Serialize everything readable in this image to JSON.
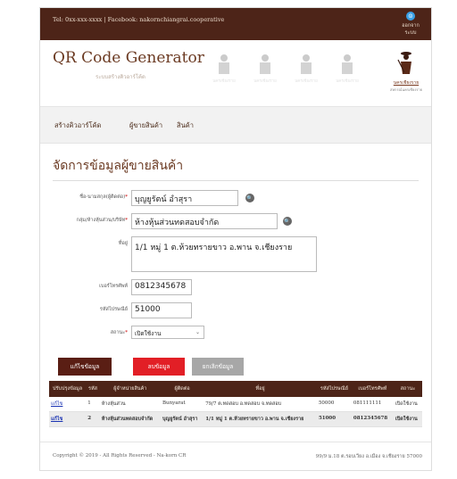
{
  "topbar": {
    "contact": "Tel: 0xx-xxx-xxxx | Facebook: nakornchiangrai.cooperative",
    "logout_label": "ออกจากระบบ",
    "avatar_glyph": "☺"
  },
  "header": {
    "app_title": "QR Code Generator",
    "app_subtitle": "ระบบสร้างคิวอาร์โค้ด",
    "emblem_caption": "นครเชียงราย",
    "logo_line1": "นครเชียงราย",
    "logo_line2": "สหกรณ์นครเชียงราย"
  },
  "nav": {
    "items": [
      {
        "label": "สร้างคิวอาร์โค้ด"
      },
      {
        "label": "ผู้ขายสินค้า"
      },
      {
        "label": "สินค้า"
      }
    ]
  },
  "form": {
    "title": "จัดการข้อมูลผู้ขายสินค้า",
    "fields": {
      "name_label": "ชื่อ-นามสกุล(ผู้ติดต่อ)",
      "name_value": "บุญยูรัตน์ อำสุรา",
      "group_label": "กลุ่ม/ห้างหุ้นส่วน/บริษัท",
      "group_value": "ห้างหุ้นส่วนทดสอบจำกัด",
      "address_label": "ที่อยู่",
      "address_value": "1/1 หมู่ 1 ต.ห้วยทรายขาว อ.พาน จ.เชียงราย",
      "phone_label": "เบอร์โทรศัพท์",
      "phone_value": "0812345678",
      "postcode_label": "รหัสไปรษณีย์",
      "postcode_value": "51000",
      "status_label": "สถานะ",
      "status_value": "เปิดใช้งาน",
      "required_mark": "*"
    },
    "buttons": {
      "edit": "แก้ไขข้อมูล",
      "delete": "ลบข้อมูล",
      "cancel": "ยกเลิกข้อมูล"
    }
  },
  "table": {
    "headers": [
      "ปรับปรุงข้อมูล",
      "รหัส",
      "ผู้จำหน่ายสินค้า",
      "ผู้ติดต่อ",
      "ที่อยู่",
      "รหัสไปรษณีย์",
      "เบอร์โทรศัพท์",
      "สถานะ"
    ],
    "rows": [
      {
        "action": "แก้ไข",
        "id": "1",
        "vendor": "ห้างหุ้นส่วน",
        "contact": "Bunyarat",
        "address": "79/7 ต.ทดสอบ อ.ทดสอบ จ.ทดสอบ",
        "postcode": "50000",
        "phone": "081111111",
        "status": "เปิดใช้งาน"
      },
      {
        "action": "แก้ไข",
        "id": "2",
        "vendor": "ห้างหุ้นส่วนทดสอบจำกัด",
        "contact": "บุญยูรัตน์ อำสุรา",
        "address": "1/1 หมู่ 1 ต.ห้วยทรายขาว อ.พาน จ.เชียงราย",
        "postcode": "51000",
        "phone": "0812345678",
        "status": "เปิดใช้งาน"
      }
    ]
  },
  "footer": {
    "copyright": "Copyright © 2019 - All Rights Reserved - Na-korn CR",
    "address": "99/9 ม.18 ต.รอบเวียง อ.เมือง จ.เชียงราย 57000"
  },
  "colors": {
    "brand_brown": "#4d2418",
    "delete_red": "#e21f26",
    "cancel_grey": "#a7a7a7"
  }
}
